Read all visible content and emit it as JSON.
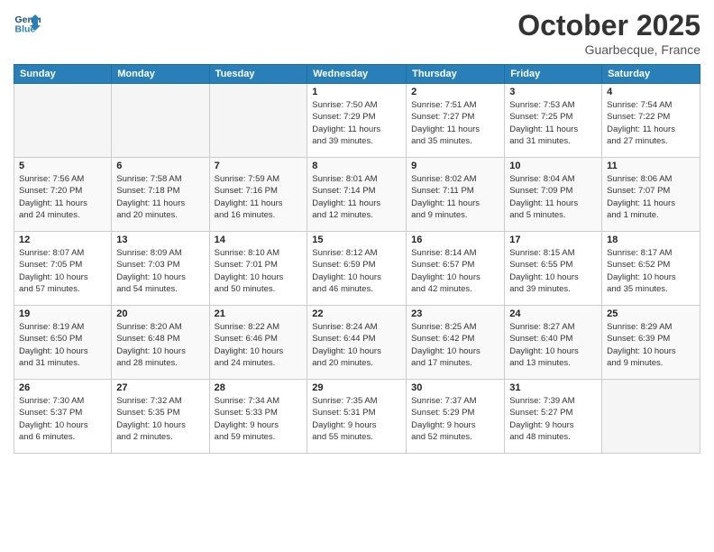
{
  "header": {
    "logo_line1": "General",
    "logo_line2": "Blue",
    "month": "October 2025",
    "location": "Guarbecque, France"
  },
  "weekdays": [
    "Sunday",
    "Monday",
    "Tuesday",
    "Wednesday",
    "Thursday",
    "Friday",
    "Saturday"
  ],
  "weeks": [
    [
      {
        "day": "",
        "info": ""
      },
      {
        "day": "",
        "info": ""
      },
      {
        "day": "",
        "info": ""
      },
      {
        "day": "1",
        "info": "Sunrise: 7:50 AM\nSunset: 7:29 PM\nDaylight: 11 hours\nand 39 minutes."
      },
      {
        "day": "2",
        "info": "Sunrise: 7:51 AM\nSunset: 7:27 PM\nDaylight: 11 hours\nand 35 minutes."
      },
      {
        "day": "3",
        "info": "Sunrise: 7:53 AM\nSunset: 7:25 PM\nDaylight: 11 hours\nand 31 minutes."
      },
      {
        "day": "4",
        "info": "Sunrise: 7:54 AM\nSunset: 7:22 PM\nDaylight: 11 hours\nand 27 minutes."
      }
    ],
    [
      {
        "day": "5",
        "info": "Sunrise: 7:56 AM\nSunset: 7:20 PM\nDaylight: 11 hours\nand 24 minutes."
      },
      {
        "day": "6",
        "info": "Sunrise: 7:58 AM\nSunset: 7:18 PM\nDaylight: 11 hours\nand 20 minutes."
      },
      {
        "day": "7",
        "info": "Sunrise: 7:59 AM\nSunset: 7:16 PM\nDaylight: 11 hours\nand 16 minutes."
      },
      {
        "day": "8",
        "info": "Sunrise: 8:01 AM\nSunset: 7:14 PM\nDaylight: 11 hours\nand 12 minutes."
      },
      {
        "day": "9",
        "info": "Sunrise: 8:02 AM\nSunset: 7:11 PM\nDaylight: 11 hours\nand 9 minutes."
      },
      {
        "day": "10",
        "info": "Sunrise: 8:04 AM\nSunset: 7:09 PM\nDaylight: 11 hours\nand 5 minutes."
      },
      {
        "day": "11",
        "info": "Sunrise: 8:06 AM\nSunset: 7:07 PM\nDaylight: 11 hours\nand 1 minute."
      }
    ],
    [
      {
        "day": "12",
        "info": "Sunrise: 8:07 AM\nSunset: 7:05 PM\nDaylight: 10 hours\nand 57 minutes."
      },
      {
        "day": "13",
        "info": "Sunrise: 8:09 AM\nSunset: 7:03 PM\nDaylight: 10 hours\nand 54 minutes."
      },
      {
        "day": "14",
        "info": "Sunrise: 8:10 AM\nSunset: 7:01 PM\nDaylight: 10 hours\nand 50 minutes."
      },
      {
        "day": "15",
        "info": "Sunrise: 8:12 AM\nSunset: 6:59 PM\nDaylight: 10 hours\nand 46 minutes."
      },
      {
        "day": "16",
        "info": "Sunrise: 8:14 AM\nSunset: 6:57 PM\nDaylight: 10 hours\nand 42 minutes."
      },
      {
        "day": "17",
        "info": "Sunrise: 8:15 AM\nSunset: 6:55 PM\nDaylight: 10 hours\nand 39 minutes."
      },
      {
        "day": "18",
        "info": "Sunrise: 8:17 AM\nSunset: 6:52 PM\nDaylight: 10 hours\nand 35 minutes."
      }
    ],
    [
      {
        "day": "19",
        "info": "Sunrise: 8:19 AM\nSunset: 6:50 PM\nDaylight: 10 hours\nand 31 minutes."
      },
      {
        "day": "20",
        "info": "Sunrise: 8:20 AM\nSunset: 6:48 PM\nDaylight: 10 hours\nand 28 minutes."
      },
      {
        "day": "21",
        "info": "Sunrise: 8:22 AM\nSunset: 6:46 PM\nDaylight: 10 hours\nand 24 minutes."
      },
      {
        "day": "22",
        "info": "Sunrise: 8:24 AM\nSunset: 6:44 PM\nDaylight: 10 hours\nand 20 minutes."
      },
      {
        "day": "23",
        "info": "Sunrise: 8:25 AM\nSunset: 6:42 PM\nDaylight: 10 hours\nand 17 minutes."
      },
      {
        "day": "24",
        "info": "Sunrise: 8:27 AM\nSunset: 6:40 PM\nDaylight: 10 hours\nand 13 minutes."
      },
      {
        "day": "25",
        "info": "Sunrise: 8:29 AM\nSunset: 6:39 PM\nDaylight: 10 hours\nand 9 minutes."
      }
    ],
    [
      {
        "day": "26",
        "info": "Sunrise: 7:30 AM\nSunset: 5:37 PM\nDaylight: 10 hours\nand 6 minutes."
      },
      {
        "day": "27",
        "info": "Sunrise: 7:32 AM\nSunset: 5:35 PM\nDaylight: 10 hours\nand 2 minutes."
      },
      {
        "day": "28",
        "info": "Sunrise: 7:34 AM\nSunset: 5:33 PM\nDaylight: 9 hours\nand 59 minutes."
      },
      {
        "day": "29",
        "info": "Sunrise: 7:35 AM\nSunset: 5:31 PM\nDaylight: 9 hours\nand 55 minutes."
      },
      {
        "day": "30",
        "info": "Sunrise: 7:37 AM\nSunset: 5:29 PM\nDaylight: 9 hours\nand 52 minutes."
      },
      {
        "day": "31",
        "info": "Sunrise: 7:39 AM\nSunset: 5:27 PM\nDaylight: 9 hours\nand 48 minutes."
      },
      {
        "day": "",
        "info": ""
      }
    ]
  ]
}
